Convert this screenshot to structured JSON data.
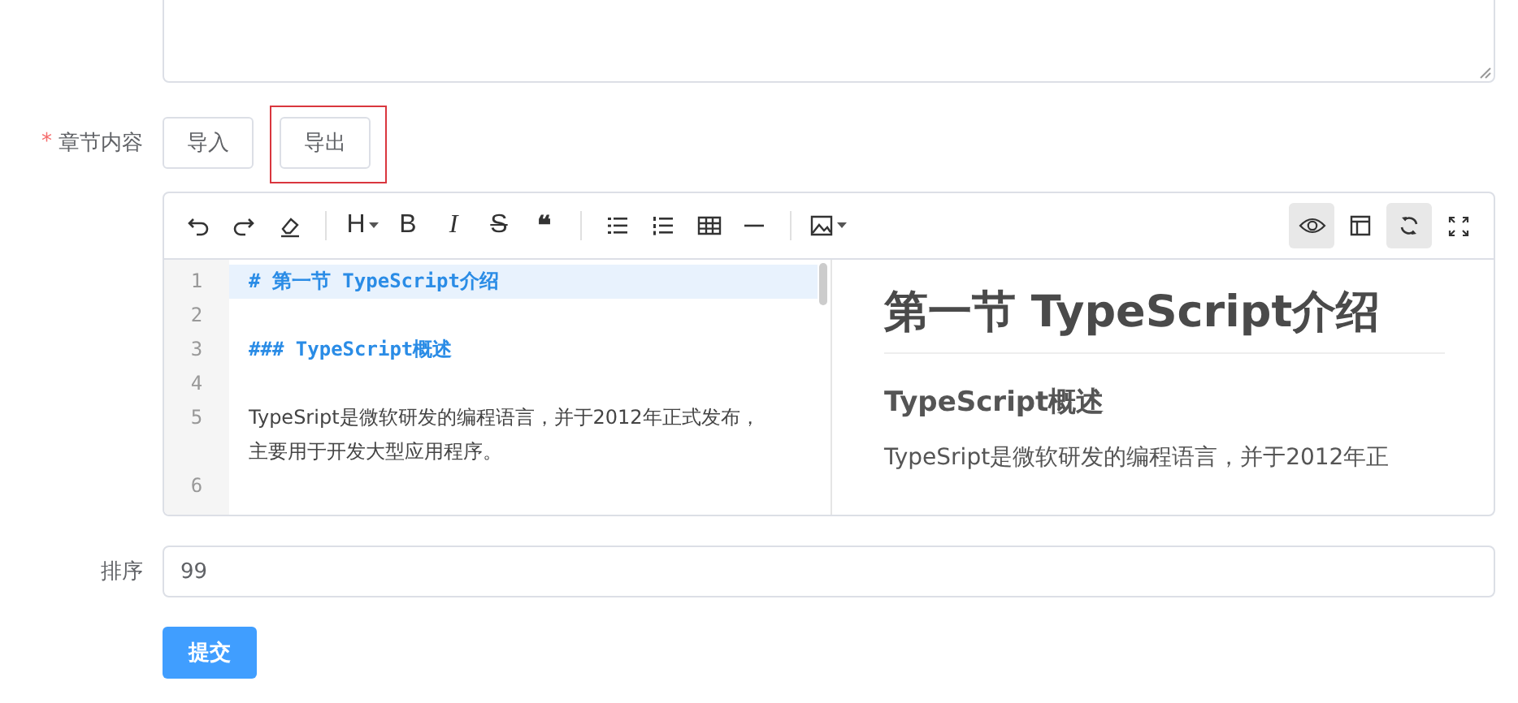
{
  "content_field": {
    "label": "章节内容",
    "required_mark": "*",
    "buttons": [
      {
        "label": "导入",
        "highlighted": false
      },
      {
        "label": "导出",
        "highlighted": true
      }
    ]
  },
  "toolbar": {
    "groups": [
      [
        {
          "kind": "undo",
          "active": false
        },
        {
          "kind": "redo",
          "active": false
        },
        {
          "kind": "eraser",
          "active": false
        }
      ],
      [
        {
          "kind": "glyph",
          "label": "H",
          "caret": true,
          "active": false
        },
        {
          "kind": "glyph",
          "label": "B",
          "active": false
        },
        {
          "kind": "glyph",
          "label": "I",
          "active": false
        },
        {
          "kind": "glyph",
          "label": "S",
          "active": false
        },
        {
          "kind": "glyph",
          "label": "❝",
          "active": false
        }
      ],
      [
        {
          "kind": "bullet-list",
          "active": false
        },
        {
          "kind": "numbered-list",
          "active": false
        },
        {
          "kind": "table",
          "active": false
        },
        {
          "kind": "rule",
          "active": false
        }
      ],
      [
        {
          "kind": "image",
          "caret": true,
          "active": false
        }
      ]
    ],
    "right": [
      {
        "kind": "preview",
        "active": true
      },
      {
        "kind": "layout",
        "active": false
      },
      {
        "kind": "sync",
        "active": true
      },
      {
        "kind": "fullscreen",
        "active": false
      }
    ]
  },
  "source_lines": [
    {
      "number": "1",
      "text": "# 第一节 TypeScript介绍",
      "kind": "heading",
      "current": true
    },
    {
      "number": "2",
      "current": false
    },
    {
      "number": "3",
      "text": "### TypeScript概述",
      "kind": "heading",
      "current": false
    },
    {
      "number": "4",
      "current": false
    },
    {
      "number": "5",
      "text": "TypeSript是微软研发的编程语言，并于2012年正式发布，主要用于开发大型应用程序。",
      "kind": "text",
      "current": false
    },
    {
      "number": "6",
      "current": false
    }
  ],
  "preview": {
    "h1": "第一节 TypeScript介绍",
    "h3": "TypeScript概述",
    "paragraph": "TypeSript是微软研发的编程语言，并于2012年正"
  },
  "order_field": {
    "label": "排序",
    "value": "99"
  },
  "submit": {
    "label": "提交"
  }
}
